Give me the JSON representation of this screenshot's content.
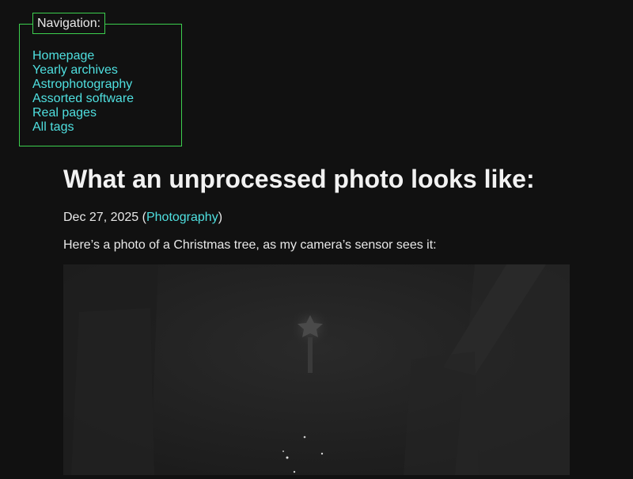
{
  "nav": {
    "legend": "Navigation:",
    "items": [
      {
        "label": "Homepage"
      },
      {
        "label": "Yearly archives"
      },
      {
        "label": "Astrophotography"
      },
      {
        "label": "Assorted software"
      },
      {
        "label": "Real pages"
      },
      {
        "label": "All tags"
      }
    ]
  },
  "article": {
    "title": "What an unprocessed photo looks like:",
    "date": "Dec 27, 2025",
    "paren_open": " (",
    "tag": "Photography",
    "paren_close": ")",
    "intro": "Here’s a photo of a Christmas tree, as my camera’s sensor sees it:"
  },
  "colors": {
    "background": "#111111",
    "link": "#4fe0e0",
    "nav_border": "#3ccf4e",
    "text": "#e8e8e8"
  }
}
